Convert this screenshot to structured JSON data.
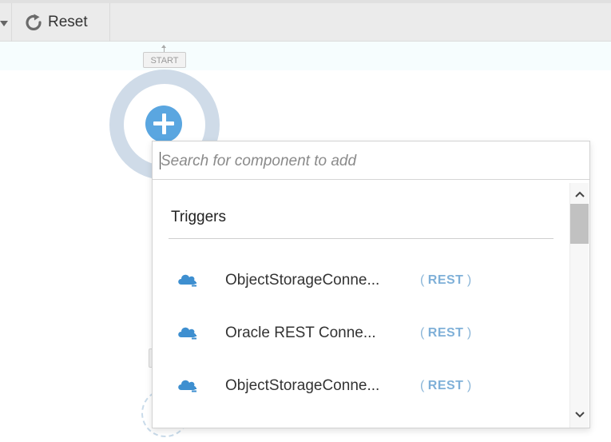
{
  "toolbar": {
    "reset_label": "Reset",
    "icons": {
      "dropdown": "caret-down-icon",
      "reset": "refresh-icon"
    }
  },
  "canvas": {
    "start_label": "START"
  },
  "popup": {
    "search": {
      "value": "",
      "placeholder": "Search for component to add"
    },
    "section_title": "Triggers",
    "items": [
      {
        "name": "ObjectStorageConne...",
        "type_open": "(",
        "type": "REST",
        "type_close": ")",
        "icon": "cloud-connection-icon"
      },
      {
        "name": "Oracle REST Conne...",
        "type_open": "(",
        "type": "REST",
        "type_close": ")",
        "icon": "cloud-connection-icon"
      },
      {
        "name": "ObjectStorageConne...",
        "type_open": "(",
        "type": "REST",
        "type_close": ")",
        "icon": "cloud-connection-icon"
      }
    ]
  },
  "colors": {
    "accent": "#5aa6e0",
    "ring": "#cfdbe8",
    "type_label": "#7fb0d8",
    "toolbar_bg": "#ebebeb"
  }
}
